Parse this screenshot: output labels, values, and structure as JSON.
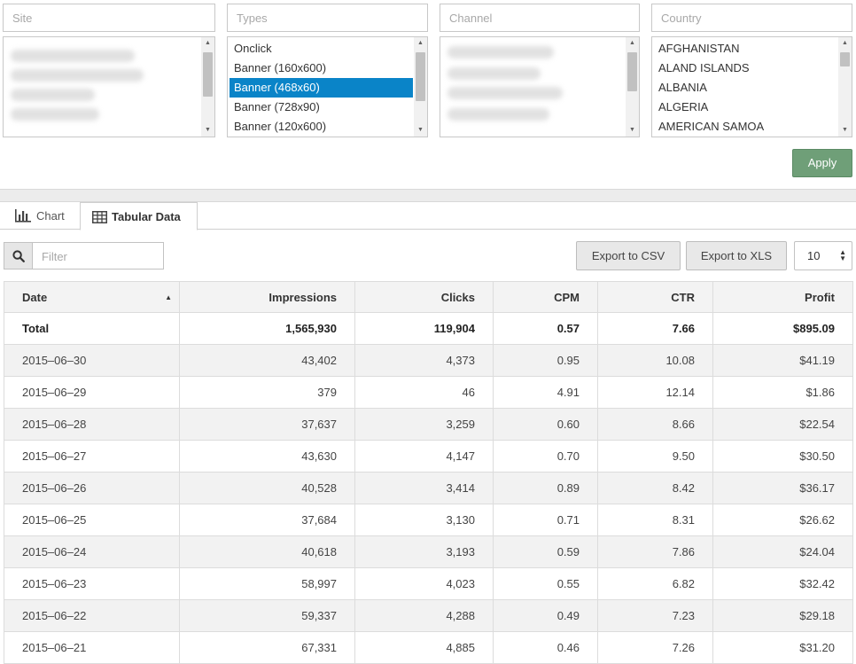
{
  "filters": {
    "site": {
      "placeholder": "Site",
      "options": []
    },
    "types": {
      "placeholder": "Types",
      "options": [
        "Onclick",
        "Banner (160x600)",
        "Banner (468x60)",
        "Banner (728x90)",
        "Banner (120x600)"
      ],
      "selected": "Banner (468x60)"
    },
    "channel": {
      "placeholder": "Channel",
      "options": []
    },
    "country": {
      "placeholder": "Country",
      "options": [
        "AFGHANISTAN",
        "ALAND ISLANDS",
        "ALBANIA",
        "ALGERIA",
        "AMERICAN SAMOA"
      ]
    }
  },
  "apply_label": "Apply",
  "colors": {
    "apply": "#6f9f78",
    "selected": "#0a84c8"
  },
  "tabs": [
    {
      "label": "Chart",
      "icon": "bar-chart-icon",
      "active": false
    },
    {
      "label": "Tabular Data",
      "icon": "table-icon",
      "active": true
    }
  ],
  "toolbar": {
    "filter_placeholder": "Filter",
    "export_csv": "Export to CSV",
    "export_xls": "Export to XLS",
    "page_size": "10",
    "search_icon": "search-icon"
  },
  "table": {
    "columns": [
      "Date",
      "Impressions",
      "Clicks",
      "CPM",
      "CTR",
      "Profit"
    ],
    "sorted_by": "Date",
    "total": [
      "Total",
      "1,565,930",
      "119,904",
      "0.57",
      "7.66",
      "$895.09"
    ],
    "rows": [
      [
        "2015–06–30",
        "43,402",
        "4,373",
        "0.95",
        "10.08",
        "$41.19"
      ],
      [
        "2015–06–29",
        "379",
        "46",
        "4.91",
        "12.14",
        "$1.86"
      ],
      [
        "2015–06–28",
        "37,637",
        "3,259",
        "0.60",
        "8.66",
        "$22.54"
      ],
      [
        "2015–06–27",
        "43,630",
        "4,147",
        "0.70",
        "9.50",
        "$30.50"
      ],
      [
        "2015–06–26",
        "40,528",
        "3,414",
        "0.89",
        "8.42",
        "$36.17"
      ],
      [
        "2015–06–25",
        "37,684",
        "3,130",
        "0.71",
        "8.31",
        "$26.62"
      ],
      [
        "2015–06–24",
        "40,618",
        "3,193",
        "0.59",
        "7.86",
        "$24.04"
      ],
      [
        "2015–06–23",
        "58,997",
        "4,023",
        "0.55",
        "6.82",
        "$32.42"
      ],
      [
        "2015–06–22",
        "59,337",
        "4,288",
        "0.49",
        "7.23",
        "$29.18"
      ],
      [
        "2015–06–21",
        "67,331",
        "4,885",
        "0.46",
        "7.26",
        "$31.20"
      ]
    ]
  }
}
